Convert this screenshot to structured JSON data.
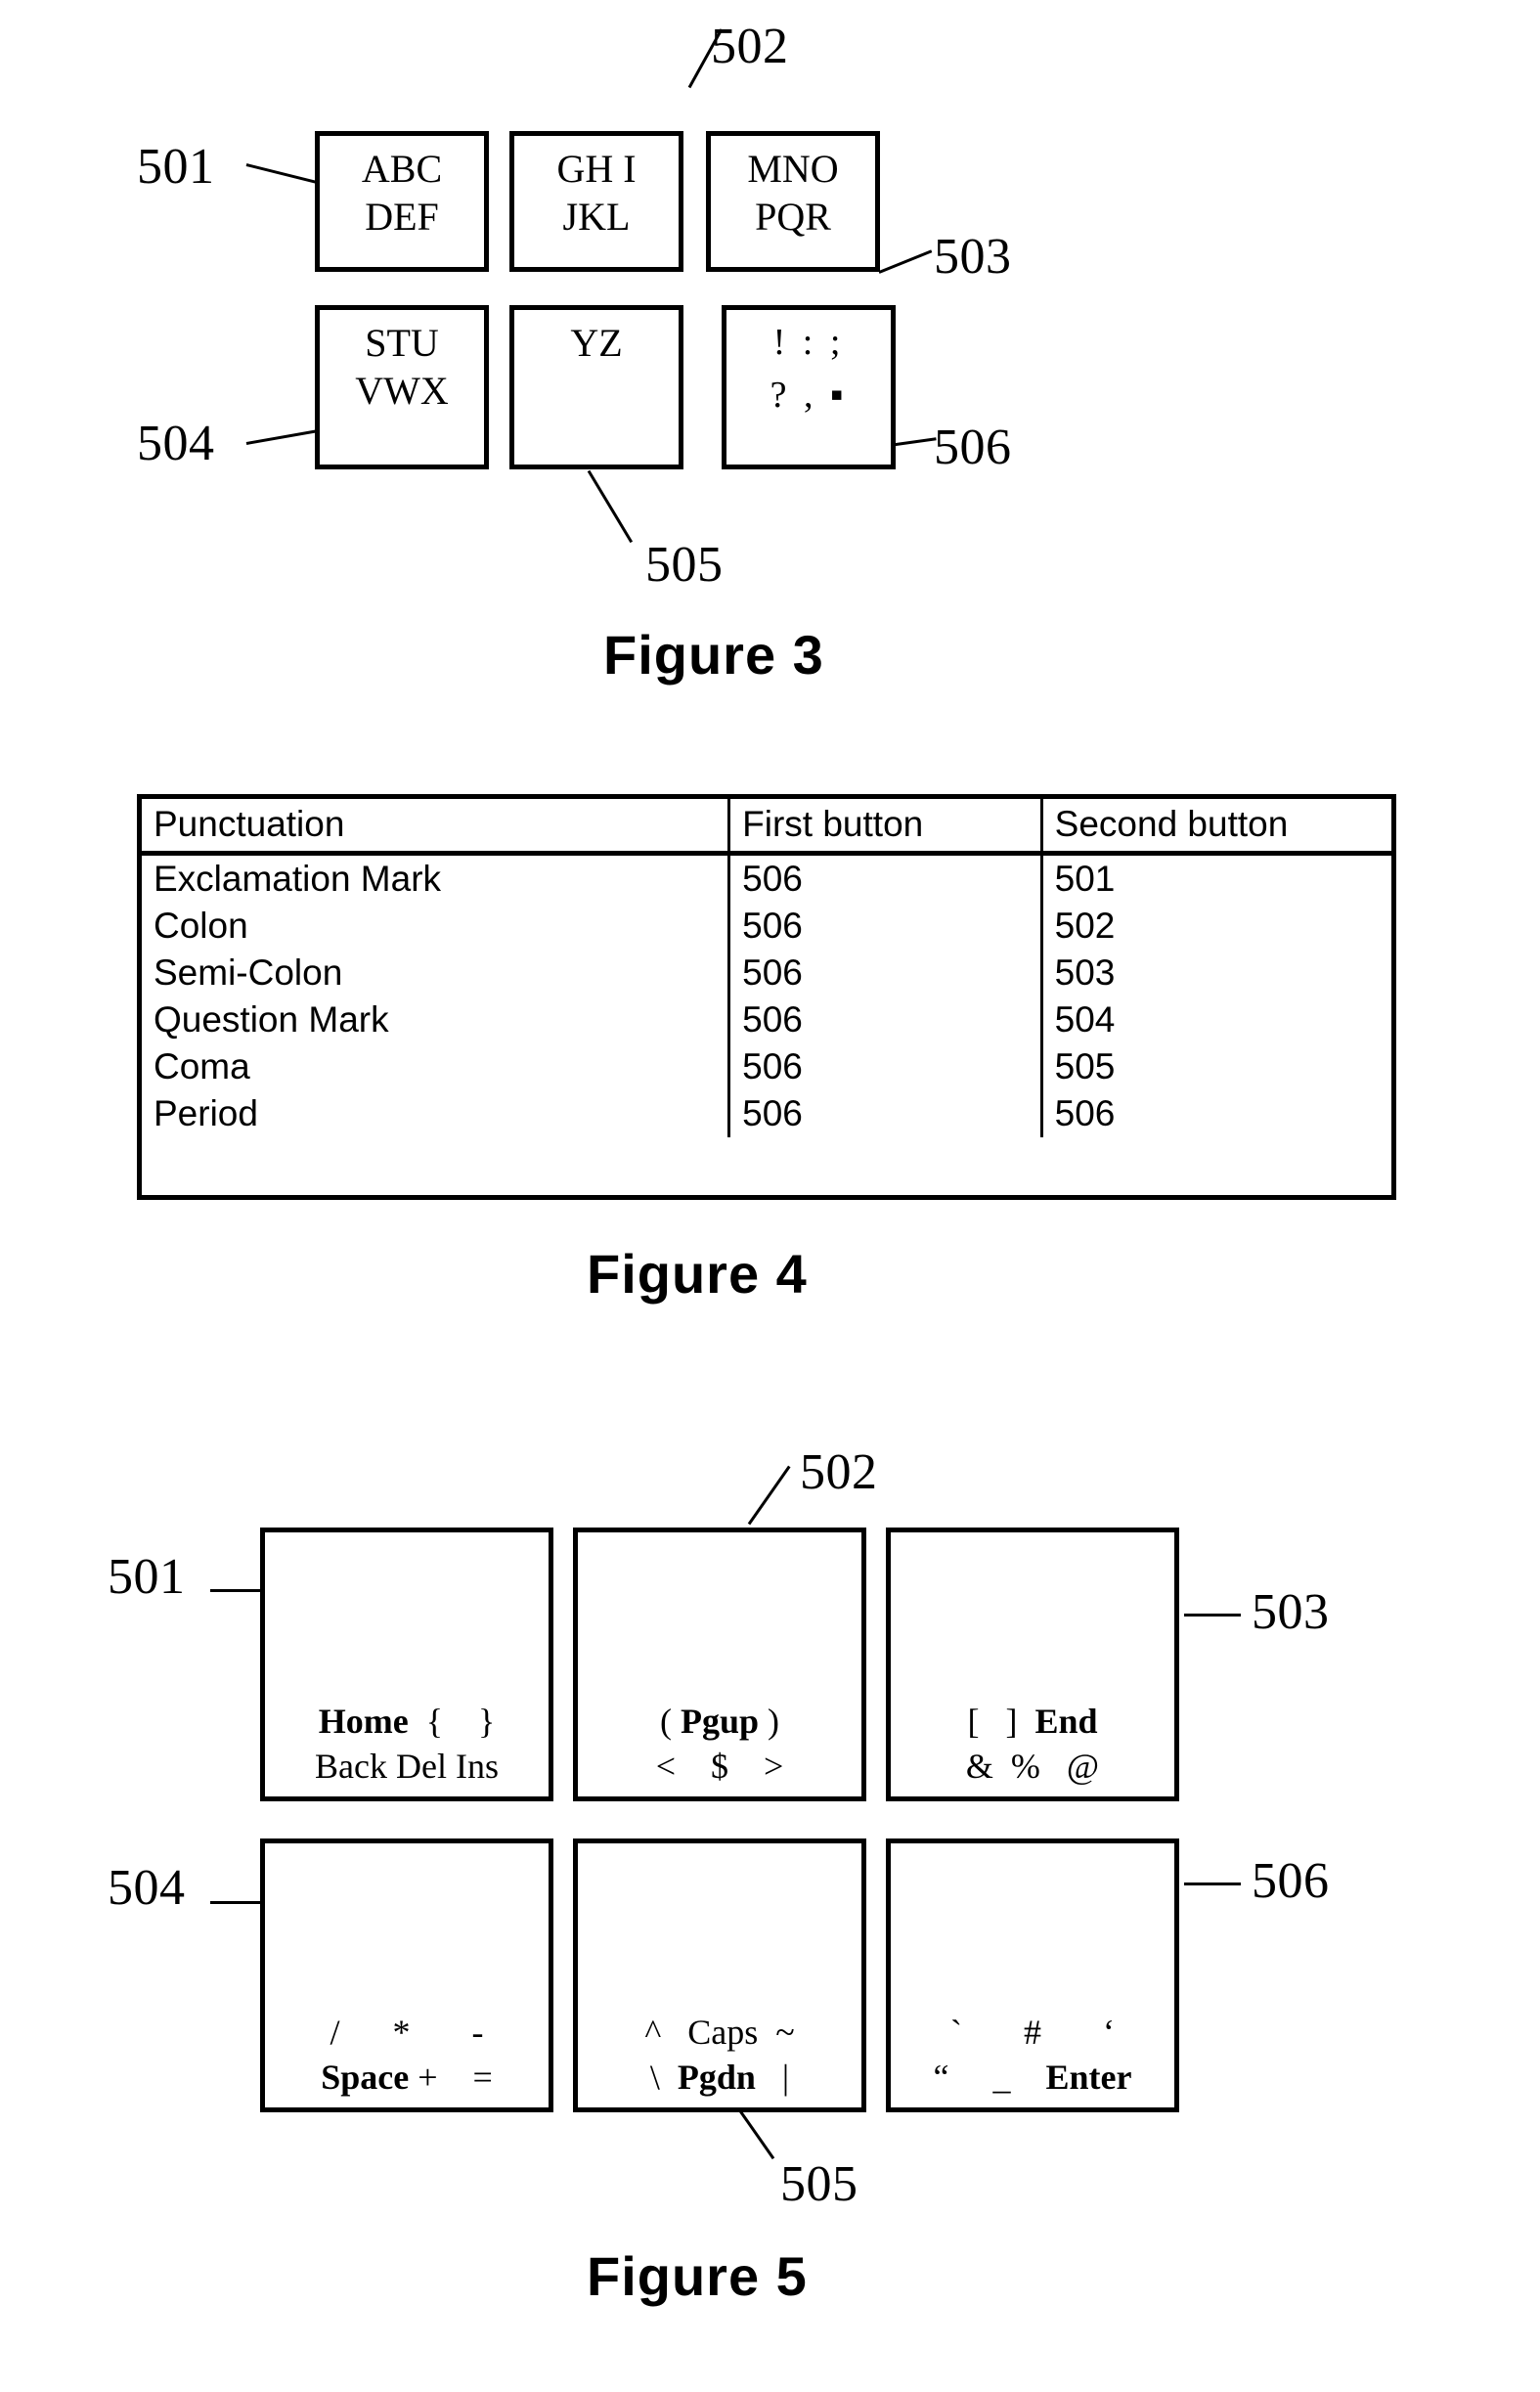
{
  "figures": [
    {
      "id": "figure-3",
      "caption": "Figure 3",
      "type": "keypad",
      "keys": [
        {
          "ref": "501",
          "line1": "ABC",
          "line2": "DEF"
        },
        {
          "ref": "502",
          "line1": "GH I",
          "line2": "JKL"
        },
        {
          "ref": "503",
          "line1": "MNO",
          "line2": "PQR"
        },
        {
          "ref": "504",
          "line1": "STU",
          "line2": "VWX"
        },
        {
          "ref": "505",
          "line1": "YZ",
          "line2": ""
        },
        {
          "ref": "506",
          "line1": "! : ;",
          "line2": "? , ."
        }
      ]
    },
    {
      "id": "figure-4",
      "caption": "Figure 4",
      "type": "table",
      "table": {
        "headers": [
          "Punctuation",
          "First button",
          "Second button"
        ],
        "rows": [
          [
            "Exclamation Mark",
            "506",
            "501"
          ],
          [
            "Colon",
            "506",
            "502"
          ],
          [
            "Semi-Colon",
            "506",
            "503"
          ],
          [
            "Question Mark",
            "506",
            "504"
          ],
          [
            "Coma",
            "506",
            "505"
          ],
          [
            "Period",
            "506",
            "506"
          ]
        ]
      }
    },
    {
      "id": "figure-5",
      "caption": "Figure 5",
      "type": "keypad",
      "keys": [
        {
          "ref": "501",
          "line1_bold": "Home",
          "line1_rest": " {  }",
          "line2": "Back Del Ins"
        },
        {
          "ref": "502",
          "line1_pre": "( ",
          "line1_bold": "Pgup",
          "line1_post": " )",
          "line2": "<   $   >"
        },
        {
          "ref": "503",
          "line1_pre": "[  ]  ",
          "line1_bold": "End",
          "line2": "&  %  @"
        },
        {
          "ref": "504",
          "line1": "/     *      -",
          "line2_bold": "Space",
          "line2_post": " +   ="
        },
        {
          "ref": "505",
          "line1": "^  Caps  ~",
          "line2_pre": "\\  ",
          "line2_bold": "Pgdn",
          "line2_post": "  |"
        },
        {
          "ref": "506",
          "line1": "`      #      ‘",
          "line2_pre": "“    _    ",
          "line2_bold": "Enter"
        }
      ]
    }
  ],
  "fig3": {
    "k501_l1": "ABC",
    "k501_l2": "DEF",
    "k502_l1": "GH I",
    "k502_l2": "JKL",
    "k503_l1": "MNO",
    "k503_l2": "PQR",
    "k504_l1": "STU",
    "k504_l2": "VWX",
    "k505_l1": "YZ",
    "k506_l1": "! : ;",
    "k506_l2": "? , ▪",
    "ref501": "501",
    "ref502": "502",
    "ref503": "503",
    "ref504": "504",
    "ref505": "505",
    "ref506": "506",
    "caption": "Figure 3"
  },
  "fig4": {
    "caption": "Figure 4",
    "h1": "Punctuation",
    "h2": "First button",
    "h3": "Second button",
    "r0c0": "Exclamation Mark",
    "r0c1": "506",
    "r0c2": "501",
    "r1c0": "Colon",
    "r1c1": "506",
    "r1c2": "502",
    "r2c0": "Semi-Colon",
    "r2c1": "506",
    "r2c2": "503",
    "r3c0": "Question Mark",
    "r3c1": "506",
    "r3c2": "504",
    "r4c0": "Coma",
    "r4c1": "506",
    "r4c2": "505",
    "r5c0": "Period",
    "r5c1": "506",
    "r5c2": "506"
  },
  "fig5": {
    "caption": "Figure 5",
    "ref501": "501",
    "ref502": "502",
    "ref503": "503",
    "ref504": "504",
    "ref505": "505",
    "ref506": "506",
    "k501_b": "Home",
    "k501_r": "  {    }",
    "k501_l2": "Back Del Ins",
    "k502_p": "( ",
    "k502_b": "Pgup",
    "k502_s": " )",
    "k502_l2": "<    $    >",
    "k503_p": "[   ]  ",
    "k503_b": "End",
    "k503_l2": "&  %   @",
    "k504_l1": "/      *       -",
    "k504_b": "Space",
    "k504_s": " +    =",
    "k505_l1": "^   Caps  ~",
    "k505_p": "\\  ",
    "k505_b": "Pgdn",
    "k505_s": "   |",
    "k506_l1": "`       #       ‘",
    "k506_p": "“     _    ",
    "k506_b": "Enter"
  },
  "colors": {
    "ink": "#000000",
    "paper": "#ffffff"
  }
}
